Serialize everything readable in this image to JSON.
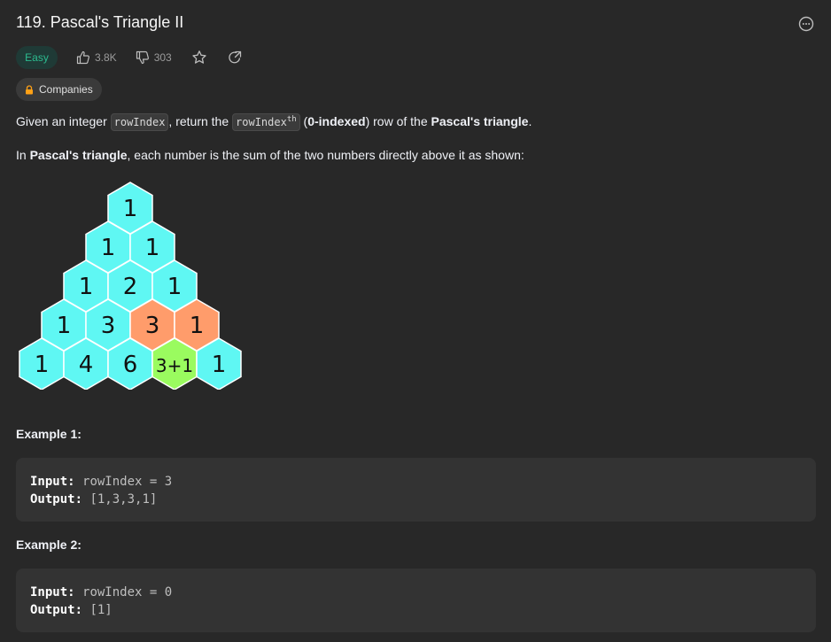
{
  "problem": {
    "title": "119. Pascal's Triangle II",
    "difficulty": "Easy",
    "likes": "3.8K",
    "dislikes": "303",
    "companies_label": "Companies"
  },
  "description": {
    "p1": {
      "before": "Given an integer ",
      "code1": "rowIndex",
      "middle": ", return the ",
      "code2": "rowIndex",
      "code2_sup": "th",
      "space": " ",
      "paren_open": "(",
      "bold1": "0-indexed",
      "paren_close": ")",
      "after1": " row of the ",
      "bold2": "Pascal's triangle",
      "end": "."
    },
    "p2": {
      "before": "In ",
      "bold": "Pascal's triangle",
      "after": ", each number is the sum of the two numbers directly above it as shown:"
    }
  },
  "triangle": {
    "rows": [
      [
        "1"
      ],
      [
        "1",
        "1"
      ],
      [
        "1",
        "2",
        "1"
      ],
      [
        "1",
        "3",
        "3",
        "1"
      ],
      [
        "1",
        "4",
        "6",
        "3+1",
        "1"
      ]
    ],
    "colors": {
      "default": "#5ff7f3",
      "highlight": "#ff9c6b",
      "sum": "#9afb5f",
      "stroke": "#ffffff"
    }
  },
  "examples": [
    {
      "title": "Example 1:",
      "input_label": "Input:",
      "input_value": "rowIndex = 3",
      "output_label": "Output:",
      "output_value": "[1,3,3,1]"
    },
    {
      "title": "Example 2:",
      "input_label": "Input:",
      "input_value": "rowIndex = 0",
      "output_label": "Output:",
      "output_value": "[1]"
    }
  ],
  "icons": {
    "more": "more-options-icon",
    "like": "thumbs-up-icon",
    "dislike": "thumbs-down-icon",
    "favorite": "star-icon",
    "share": "share-icon",
    "lock": "lock-icon"
  }
}
